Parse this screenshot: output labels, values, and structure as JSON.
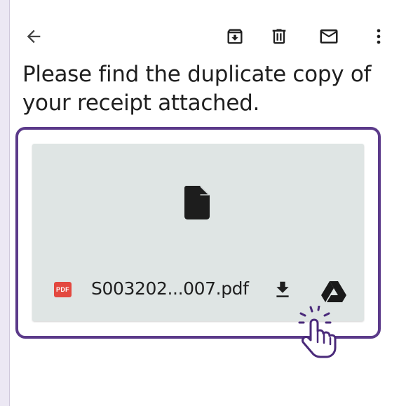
{
  "toolbar": {
    "icons": [
      "arrow-left-icon",
      "archive-icon",
      "trash-icon",
      "mail-icon",
      "more-vert-icon"
    ]
  },
  "message": {
    "body": "Please find the duplicate copy of your receipt attached."
  },
  "attachment": {
    "type_badge": "PDF",
    "filename": "S003202...007.pdf"
  },
  "colors": {
    "highlight": "#5b3a8a",
    "pdf_badge": "#e3483f",
    "card_background": "#dfe5e4"
  }
}
